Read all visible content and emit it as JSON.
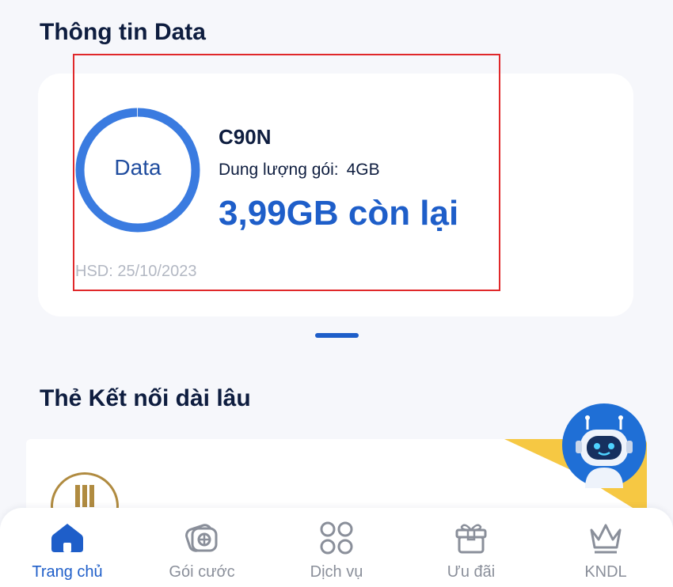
{
  "data_section": {
    "title": "Thông tin Data",
    "ring_label": "Data",
    "package_name": "C90N",
    "capacity_label": "Dung lượng gói:",
    "capacity_value": "4GB",
    "remaining": "3,99GB còn lại",
    "expiry": "HSD: 25/10/2023",
    "remaining_fraction": 0.9975
  },
  "kn_section": {
    "title": "Thẻ Kết nối dài lâu"
  },
  "bottom_nav": {
    "items": [
      {
        "label": "Trang chủ",
        "icon": "home-icon",
        "active": true
      },
      {
        "label": "Gói cước",
        "icon": "package-icon",
        "active": false
      },
      {
        "label": "Dịch vụ",
        "icon": "services-grid-icon",
        "active": false
      },
      {
        "label": "Ưu đãi",
        "icon": "gift-icon",
        "active": false
      },
      {
        "label": "KNDL",
        "icon": "crown-icon",
        "active": false
      }
    ]
  },
  "colors": {
    "accent": "#1e5ec9",
    "ring": "#3a7be0",
    "title": "#0e1d3f",
    "highlight": "#e0282a",
    "banner_yellow": "#f6c843"
  }
}
